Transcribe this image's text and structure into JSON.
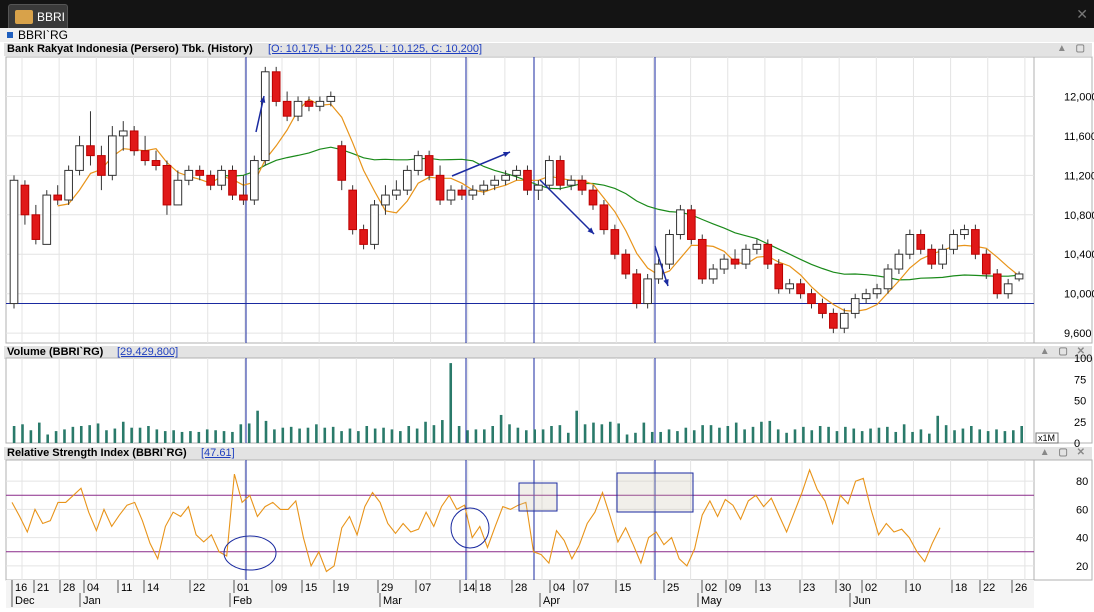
{
  "window": {
    "tab_label": "BBRI"
  },
  "symbol": {
    "name": "BBRI`RG"
  },
  "price_panel": {
    "title": "Bank Rakyat Indonesia (Persero) Tbk. (History)",
    "ohlc": "[O: 10,175,  H: 10,225,  L: 10,125,  C: 10,200]",
    "y_ticks": [
      "12,000",
      "11,600",
      "11,200",
      "10,800",
      "10,400",
      "10,000",
      "9,600"
    ],
    "controls": "▲ ▢"
  },
  "volume_panel": {
    "title": "Volume (BBRI`RG)",
    "value": "[29,429,800]",
    "y_ticks": [
      "100",
      "75",
      "50",
      "25",
      "0"
    ],
    "scale_badge": "x1M",
    "controls": "▲ ▢ ✕"
  },
  "rsi_panel": {
    "title": "Relative Strength Index (BBRI`RG)",
    "value": "[47.61]",
    "y_ticks": [
      "80",
      "60",
      "40",
      "20"
    ],
    "controls": "▲ ▢ ✕"
  },
  "x_axis": {
    "days": [
      "16",
      "21",
      "28",
      "04",
      "11",
      "14",
      "22",
      "01",
      "09",
      "15",
      "19",
      "29",
      "07",
      "14",
      "18",
      "28",
      "04",
      "07",
      "15",
      "25",
      "02",
      "09",
      "13",
      "23",
      "30",
      "02",
      "10",
      "18",
      "22",
      "26"
    ],
    "months": [
      "Dec",
      "Jan",
      "Feb",
      "Mar",
      "Apr",
      "May",
      "Jun"
    ]
  },
  "colors": {
    "up": "#ffffff",
    "down": "#e01818",
    "ma_fast": "#e8941a",
    "ma_slow": "#1a8a1a",
    "volume": "#2a7a6a",
    "rsi": "#e8941a",
    "marker": "#1a2aa0",
    "band": "#8a2a8a"
  },
  "chart_data": {
    "type": "candlestick",
    "ylim": [
      9500,
      12400
    ],
    "candles": [
      {
        "o": 9900,
        "h": 11200,
        "l": 9850,
        "c": 11150
      },
      {
        "o": 11100,
        "h": 11150,
        "l": 10700,
        "c": 10800
      },
      {
        "o": 10800,
        "h": 10900,
        "l": 10500,
        "c": 10550
      },
      {
        "o": 10500,
        "h": 11050,
        "l": 10500,
        "c": 11000
      },
      {
        "o": 11000,
        "h": 11100,
        "l": 10900,
        "c": 10950
      },
      {
        "o": 10950,
        "h": 11300,
        "l": 10900,
        "c": 11250
      },
      {
        "o": 11250,
        "h": 11600,
        "l": 11200,
        "c": 11500
      },
      {
        "o": 11500,
        "h": 11850,
        "l": 11300,
        "c": 11400
      },
      {
        "o": 11400,
        "h": 11500,
        "l": 11050,
        "c": 11200
      },
      {
        "o": 11200,
        "h": 11700,
        "l": 11150,
        "c": 11600
      },
      {
        "o": 11600,
        "h": 11750,
        "l": 11450,
        "c": 11650
      },
      {
        "o": 11650,
        "h": 11700,
        "l": 11400,
        "c": 11450
      },
      {
        "o": 11450,
        "h": 11600,
        "l": 11300,
        "c": 11350
      },
      {
        "o": 11350,
        "h": 11450,
        "l": 11250,
        "c": 11300
      },
      {
        "o": 11300,
        "h": 11350,
        "l": 10800,
        "c": 10900
      },
      {
        "o": 10900,
        "h": 11250,
        "l": 10900,
        "c": 11150
      },
      {
        "o": 11150,
        "h": 11300,
        "l": 11100,
        "c": 11250
      },
      {
        "o": 11250,
        "h": 11300,
        "l": 11150,
        "c": 11200
      },
      {
        "o": 11200,
        "h": 11250,
        "l": 11050,
        "c": 11100
      },
      {
        "o": 11100,
        "h": 11300,
        "l": 11050,
        "c": 11250
      },
      {
        "o": 11250,
        "h": 11300,
        "l": 10950,
        "c": 11000
      },
      {
        "o": 11000,
        "h": 11200,
        "l": 10900,
        "c": 10950
      },
      {
        "o": 10950,
        "h": 11400,
        "l": 10900,
        "c": 11350
      },
      {
        "o": 11350,
        "h": 12300,
        "l": 11300,
        "c": 12250
      },
      {
        "o": 12250,
        "h": 12300,
        "l": 11900,
        "c": 11950
      },
      {
        "o": 11950,
        "h": 12050,
        "l": 11750,
        "c": 11800
      },
      {
        "o": 11800,
        "h": 12000,
        "l": 11750,
        "c": 11950
      },
      {
        "o": 11950,
        "h": 12000,
        "l": 11850,
        "c": 11900
      },
      {
        "o": 11900,
        "h": 12000,
        "l": 11850,
        "c": 11950
      },
      {
        "o": 11950,
        "h": 12050,
        "l": 11900,
        "c": 12000
      },
      {
        "o": 11500,
        "h": 11550,
        "l": 11050,
        "c": 11150
      },
      {
        "o": 11050,
        "h": 11100,
        "l": 10600,
        "c": 10650
      },
      {
        "o": 10650,
        "h": 10700,
        "l": 10450,
        "c": 10500
      },
      {
        "o": 10500,
        "h": 10950,
        "l": 10450,
        "c": 10900
      },
      {
        "o": 10900,
        "h": 11100,
        "l": 10800,
        "c": 11000
      },
      {
        "o": 11000,
        "h": 11150,
        "l": 10950,
        "c": 11050
      },
      {
        "o": 11050,
        "h": 11300,
        "l": 11000,
        "c": 11250
      },
      {
        "o": 11250,
        "h": 11450,
        "l": 11200,
        "c": 11400
      },
      {
        "o": 11400,
        "h": 11450,
        "l": 11150,
        "c": 11200
      },
      {
        "o": 11200,
        "h": 11300,
        "l": 10900,
        "c": 10950
      },
      {
        "o": 10950,
        "h": 11100,
        "l": 10900,
        "c": 11050
      },
      {
        "o": 11050,
        "h": 11100,
        "l": 10950,
        "c": 11000
      },
      {
        "o": 11000,
        "h": 11100,
        "l": 10950,
        "c": 11050
      },
      {
        "o": 11050,
        "h": 11150,
        "l": 11000,
        "c": 11100
      },
      {
        "o": 11100,
        "h": 11200,
        "l": 11050,
        "c": 11150
      },
      {
        "o": 11150,
        "h": 11250,
        "l": 11100,
        "c": 11200
      },
      {
        "o": 11200,
        "h": 11300,
        "l": 11150,
        "c": 11250
      },
      {
        "o": 11250,
        "h": 11300,
        "l": 11000,
        "c": 11050
      },
      {
        "o": 11050,
        "h": 11150,
        "l": 10950,
        "c": 11100
      },
      {
        "o": 11100,
        "h": 11400,
        "l": 11050,
        "c": 11350
      },
      {
        "o": 11350,
        "h": 11400,
        "l": 11050,
        "c": 11100
      },
      {
        "o": 11100,
        "h": 11200,
        "l": 11050,
        "c": 11150
      },
      {
        "o": 11150,
        "h": 11200,
        "l": 11000,
        "c": 11050
      },
      {
        "o": 11050,
        "h": 11100,
        "l": 10850,
        "c": 10900
      },
      {
        "o": 10900,
        "h": 10950,
        "l": 10600,
        "c": 10650
      },
      {
        "o": 10650,
        "h": 10700,
        "l": 10350,
        "c": 10400
      },
      {
        "o": 10400,
        "h": 10450,
        "l": 10150,
        "c": 10200
      },
      {
        "o": 10200,
        "h": 10250,
        "l": 9850,
        "c": 9900
      },
      {
        "o": 9900,
        "h": 10200,
        "l": 9850,
        "c": 10150
      },
      {
        "o": 10150,
        "h": 10350,
        "l": 10100,
        "c": 10300
      },
      {
        "o": 10300,
        "h": 10650,
        "l": 10250,
        "c": 10600
      },
      {
        "o": 10600,
        "h": 10900,
        "l": 10550,
        "c": 10850
      },
      {
        "o": 10850,
        "h": 10900,
        "l": 10500,
        "c": 10550
      },
      {
        "o": 10550,
        "h": 10600,
        "l": 10100,
        "c": 10150
      },
      {
        "o": 10150,
        "h": 10300,
        "l": 10100,
        "c": 10250
      },
      {
        "o": 10250,
        "h": 10400,
        "l": 10200,
        "c": 10350
      },
      {
        "o": 10350,
        "h": 10450,
        "l": 10250,
        "c": 10300
      },
      {
        "o": 10300,
        "h": 10500,
        "l": 10250,
        "c": 10450
      },
      {
        "o": 10450,
        "h": 10550,
        "l": 10400,
        "c": 10500
      },
      {
        "o": 10500,
        "h": 10550,
        "l": 10250,
        "c": 10300
      },
      {
        "o": 10300,
        "h": 10350,
        "l": 10000,
        "c": 10050
      },
      {
        "o": 10050,
        "h": 10150,
        "l": 10000,
        "c": 10100
      },
      {
        "o": 10100,
        "h": 10150,
        "l": 9950,
        "c": 10000
      },
      {
        "o": 10000,
        "h": 10050,
        "l": 9850,
        "c": 9900
      },
      {
        "o": 9900,
        "h": 9950,
        "l": 9750,
        "c": 9800
      },
      {
        "o": 9800,
        "h": 9850,
        "l": 9600,
        "c": 9650
      },
      {
        "o": 9650,
        "h": 9850,
        "l": 9600,
        "c": 9800
      },
      {
        "o": 9800,
        "h": 10000,
        "l": 9750,
        "c": 9950
      },
      {
        "o": 9950,
        "h": 10050,
        "l": 9900,
        "c": 10000
      },
      {
        "o": 10000,
        "h": 10100,
        "l": 9950,
        "c": 10050
      },
      {
        "o": 10050,
        "h": 10300,
        "l": 10000,
        "c": 10250
      },
      {
        "o": 10250,
        "h": 10450,
        "l": 10200,
        "c": 10400
      },
      {
        "o": 10400,
        "h": 10650,
        "l": 10350,
        "c": 10600
      },
      {
        "o": 10600,
        "h": 10650,
        "l": 10400,
        "c": 10450
      },
      {
        "o": 10450,
        "h": 10500,
        "l": 10250,
        "c": 10300
      },
      {
        "o": 10300,
        "h": 10500,
        "l": 10250,
        "c": 10450
      },
      {
        "o": 10450,
        "h": 10650,
        "l": 10400,
        "c": 10600
      },
      {
        "o": 10600,
        "h": 10700,
        "l": 10550,
        "c": 10650
      },
      {
        "o": 10650,
        "h": 10700,
        "l": 10350,
        "c": 10400
      },
      {
        "o": 10400,
        "h": 10450,
        "l": 10150,
        "c": 10200
      },
      {
        "o": 10200,
        "h": 10250,
        "l": 9950,
        "c": 10000
      },
      {
        "o": 10000,
        "h": 10150,
        "l": 9950,
        "c": 10100
      },
      {
        "o": 10150,
        "h": 10225,
        "l": 10125,
        "c": 10200
      }
    ],
    "volume": [
      20,
      22,
      15,
      24,
      10,
      14,
      16,
      19,
      20,
      21,
      23,
      15,
      17,
      25,
      18,
      18,
      20,
      16,
      14,
      15,
      13,
      14,
      13,
      16,
      15,
      14,
      13,
      22,
      23,
      38,
      26,
      16,
      18,
      19,
      17,
      18,
      22,
      18,
      19,
      14,
      17,
      14,
      20,
      17,
      18,
      16,
      14,
      20,
      17,
      25,
      21,
      27,
      94,
      20,
      15,
      16,
      16,
      20,
      33,
      22,
      18,
      15,
      16,
      16,
      20,
      21,
      12,
      38,
      22,
      24,
      22,
      25,
      23,
      10,
      12,
      24,
      13,
      13,
      16,
      14,
      18,
      15,
      21,
      21,
      18,
      20,
      24,
      16,
      19,
      25,
      26,
      16,
      12,
      16,
      19,
      15,
      20,
      19,
      14,
      19,
      17,
      14,
      17,
      18,
      19,
      13,
      22,
      13,
      16,
      11,
      32,
      21,
      15,
      17,
      20,
      16,
      14,
      16,
      14,
      15,
      20
    ],
    "volume_ylim": [
      0,
      100
    ],
    "rsi": [
      65,
      55,
      44,
      60,
      50,
      52,
      65,
      65,
      70,
      75,
      58,
      45,
      60,
      48,
      56,
      63,
      65,
      52,
      36,
      25,
      48,
      58,
      55,
      62,
      42,
      37,
      42,
      30,
      27,
      85,
      65,
      70,
      55,
      62,
      65,
      60,
      60,
      66,
      40,
      20,
      30,
      16,
      20,
      47,
      55,
      42,
      62,
      72,
      65,
      50,
      43,
      50,
      44,
      46,
      58,
      48,
      62,
      70,
      60,
      63,
      40,
      48,
      33,
      48,
      62,
      60,
      63,
      65,
      30,
      28,
      22,
      45,
      38,
      25,
      35,
      50,
      58,
      72,
      55,
      37,
      47,
      35,
      22,
      40,
      44,
      35,
      40,
      25,
      20,
      32,
      56,
      66,
      55,
      67,
      63,
      53,
      66,
      70,
      62,
      68,
      56,
      44,
      58,
      72,
      88,
      74,
      66,
      50,
      70,
      64,
      80,
      82,
      60,
      42,
      50,
      44,
      46,
      40,
      30,
      23,
      36,
      47
    ],
    "rsi_ylim": [
      10,
      95
    ],
    "rsi_levels": [
      70,
      30
    ],
    "price_hline": 9900
  }
}
